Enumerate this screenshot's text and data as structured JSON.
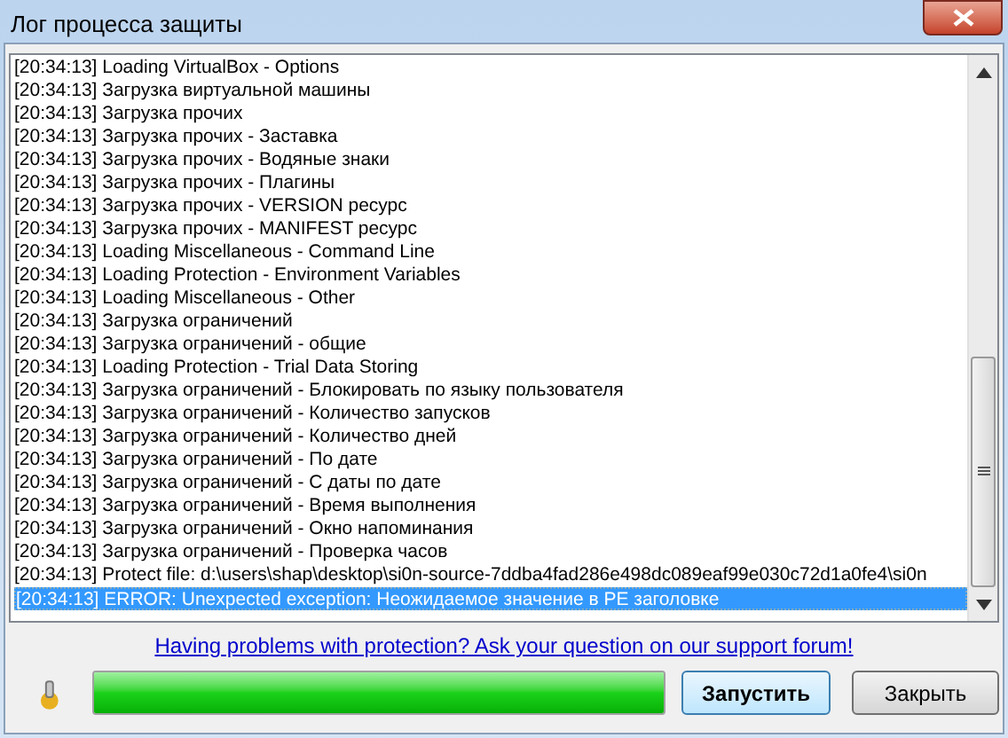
{
  "window": {
    "title": "Лог процесса защиты"
  },
  "log": {
    "rows": [
      {
        "text": "[20:34:13] Loading VirtualBox - Options",
        "selected": false
      },
      {
        "text": "[20:34:13] Загрузка виртуальной машины",
        "selected": false
      },
      {
        "text": "[20:34:13] Загрузка прочих",
        "selected": false
      },
      {
        "text": "[20:34:13] Загрузка прочих - Заставка",
        "selected": false
      },
      {
        "text": "[20:34:13] Загрузка прочих - Водяные знаки",
        "selected": false
      },
      {
        "text": "[20:34:13] Загрузка прочих - Плагины",
        "selected": false
      },
      {
        "text": "[20:34:13] Загрузка прочих - VERSION ресурс",
        "selected": false
      },
      {
        "text": "[20:34:13] Загрузка прочих - MANIFEST ресурс",
        "selected": false
      },
      {
        "text": "[20:34:13] Loading Miscellaneous - Command Line",
        "selected": false
      },
      {
        "text": "[20:34:13] Loading Protection - Environment Variables",
        "selected": false
      },
      {
        "text": "[20:34:13] Loading Miscellaneous - Other",
        "selected": false
      },
      {
        "text": "[20:34:13] Загрузка ограничений",
        "selected": false
      },
      {
        "text": "[20:34:13] Загрузка ограничений - общие",
        "selected": false
      },
      {
        "text": "[20:34:13] Loading Protection - Trial Data Storing",
        "selected": false
      },
      {
        "text": "[20:34:13] Загрузка ограничений - Блокировать по языку пользователя",
        "selected": false
      },
      {
        "text": "[20:34:13] Загрузка ограничений - Количество запусков",
        "selected": false
      },
      {
        "text": "[20:34:13] Загрузка ограничений - Количество дней",
        "selected": false
      },
      {
        "text": "[20:34:13] Загрузка ограничений - По дате",
        "selected": false
      },
      {
        "text": "[20:34:13] Загрузка ограничений - С даты по дате",
        "selected": false
      },
      {
        "text": "[20:34:13] Загрузка ограничений - Время выполнения",
        "selected": false
      },
      {
        "text": "[20:34:13] Загрузка ограничений - Окно напоминания",
        "selected": false
      },
      {
        "text": "[20:34:13] Загрузка ограничений - Проверка часов",
        "selected": false
      },
      {
        "text": "[20:34:13] Protect file: d:\\users\\shap\\desktop\\si0n-source-7ddba4fad286e498dc089eaf99e030c72d1a0fe4\\si0n",
        "selected": false
      },
      {
        "text": "[20:34:13] ERROR: Unexpected exception: Неожидаемое значение в PE заголовке",
        "selected": true
      }
    ]
  },
  "support_link": "Having problems with protection? Ask your question on our support forum!",
  "progress": {
    "level": 1
  },
  "buttons": [
    {
      "label": "Запустить",
      "default": true
    },
    {
      "label": "Закрыть",
      "default": false
    }
  ]
}
